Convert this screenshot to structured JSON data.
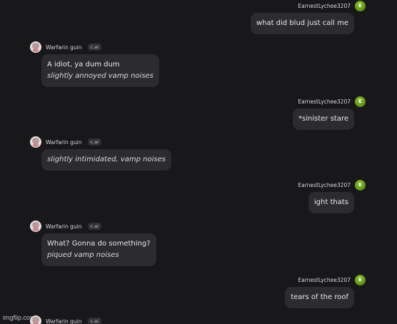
{
  "user": {
    "name": "EarnestLychee3207",
    "avatar_letter": "E"
  },
  "bot": {
    "name": "Warfarin guin",
    "tag": "c.ai"
  },
  "messages": [
    {
      "role": "user",
      "text": "what did blud just call me"
    },
    {
      "role": "bot",
      "text": "A idiot, ya dum dum",
      "action": "slightly annoyed vamp noises"
    },
    {
      "role": "user",
      "text": "*sinister stare"
    },
    {
      "role": "bot",
      "text": "",
      "action": "slightly intimidated, vamp noises"
    },
    {
      "role": "user",
      "text": "ight thats"
    },
    {
      "role": "bot",
      "text": "What? Gonna do something?",
      "action": "piqued vamp noises"
    },
    {
      "role": "user",
      "text": "tears of the roof"
    },
    {
      "role": "bot",
      "text": "",
      "action": ""
    }
  ],
  "watermark": "imgflip.com",
  "colors": {
    "background": "#18181b",
    "bubble": "#2b2b30",
    "user_avatar": "#6e9e1e"
  }
}
